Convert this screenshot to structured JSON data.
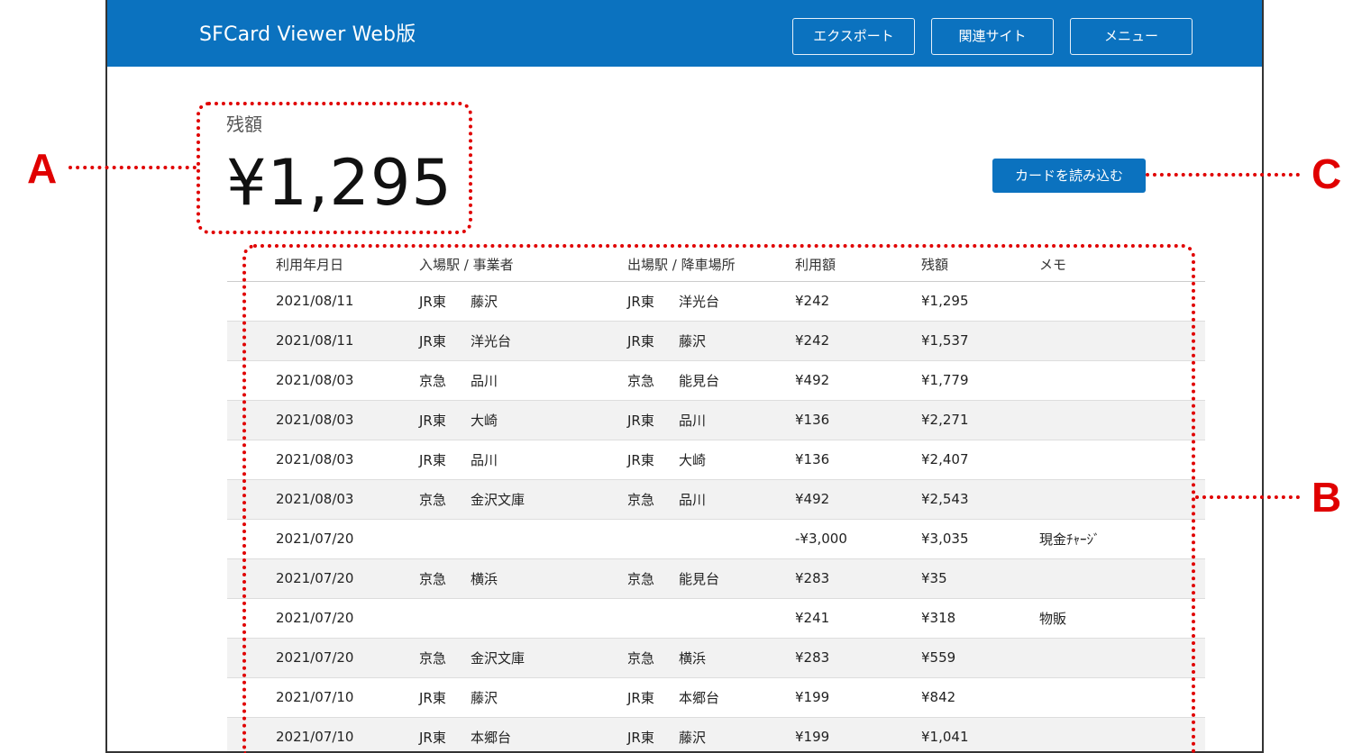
{
  "header": {
    "title": "SFCard Viewer Web版",
    "buttons": {
      "export": "エクスポート",
      "related_sites": "関連サイト",
      "menu": "メニュー"
    }
  },
  "balance": {
    "label": "残額",
    "value": "¥1,295"
  },
  "read_card_button": "カードを読み込む",
  "table": {
    "headers": {
      "date": "利用年月日",
      "entry": "入場駅 / 事業者",
      "exit": "出場駅 / 降車場所",
      "amount": "利用額",
      "balance": "残額",
      "memo": "メモ"
    },
    "rows": [
      {
        "date": "2021/08/11",
        "in_op": "JR東",
        "in_st": "藤沢",
        "out_op": "JR東",
        "out_st": "洋光台",
        "amount": "¥242",
        "balance": "¥1,295",
        "memo": ""
      },
      {
        "date": "2021/08/11",
        "in_op": "JR東",
        "in_st": "洋光台",
        "out_op": "JR東",
        "out_st": "藤沢",
        "amount": "¥242",
        "balance": "¥1,537",
        "memo": ""
      },
      {
        "date": "2021/08/03",
        "in_op": "京急",
        "in_st": "品川",
        "out_op": "京急",
        "out_st": "能見台",
        "amount": "¥492",
        "balance": "¥1,779",
        "memo": ""
      },
      {
        "date": "2021/08/03",
        "in_op": "JR東",
        "in_st": "大崎",
        "out_op": "JR東",
        "out_st": "品川",
        "amount": "¥136",
        "balance": "¥2,271",
        "memo": ""
      },
      {
        "date": "2021/08/03",
        "in_op": "JR東",
        "in_st": "品川",
        "out_op": "JR東",
        "out_st": "大崎",
        "amount": "¥136",
        "balance": "¥2,407",
        "memo": ""
      },
      {
        "date": "2021/08/03",
        "in_op": "京急",
        "in_st": "金沢文庫",
        "out_op": "京急",
        "out_st": "品川",
        "amount": "¥492",
        "balance": "¥2,543",
        "memo": ""
      },
      {
        "date": "2021/07/20",
        "in_op": "",
        "in_st": "",
        "out_op": "",
        "out_st": "",
        "amount": "-¥3,000",
        "balance": "¥3,035",
        "memo": "現金ﾁｬｰｼﾞ"
      },
      {
        "date": "2021/07/20",
        "in_op": "京急",
        "in_st": "横浜",
        "out_op": "京急",
        "out_st": "能見台",
        "amount": "¥283",
        "balance": "¥35",
        "memo": ""
      },
      {
        "date": "2021/07/20",
        "in_op": "",
        "in_st": "",
        "out_op": "",
        "out_st": "",
        "amount": "¥241",
        "balance": "¥318",
        "memo": "物販"
      },
      {
        "date": "2021/07/20",
        "in_op": "京急",
        "in_st": "金沢文庫",
        "out_op": "京急",
        "out_st": "横浜",
        "amount": "¥283",
        "balance": "¥559",
        "memo": ""
      },
      {
        "date": "2021/07/10",
        "in_op": "JR東",
        "in_st": "藤沢",
        "out_op": "JR東",
        "out_st": "本郷台",
        "amount": "¥199",
        "balance": "¥842",
        "memo": ""
      },
      {
        "date": "2021/07/10",
        "in_op": "JR東",
        "in_st": "本郷台",
        "out_op": "JR東",
        "out_st": "藤沢",
        "amount": "¥199",
        "balance": "¥1,041",
        "memo": ""
      }
    ]
  },
  "annotations": {
    "a": "A",
    "b": "B",
    "c": "C"
  },
  "colors": {
    "header_bg": "#0b72bf",
    "callout": "#e00000",
    "alt_row": "#f2f2f2"
  }
}
